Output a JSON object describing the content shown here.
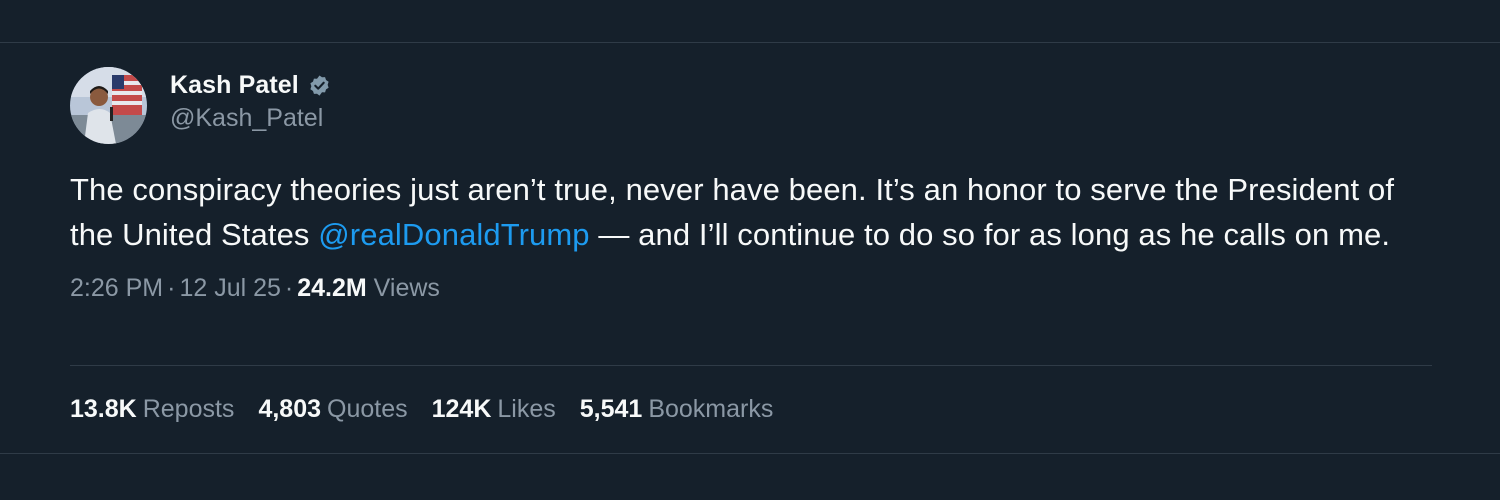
{
  "author": {
    "display_name": "Kash Patel",
    "handle": "@Kash_Patel",
    "verified_icon": "verified-badge-icon"
  },
  "tweet": {
    "text_part1": "The conspiracy theories just aren’t true, never have been. It’s an honor to serve the President of the United States ",
    "mention": "@realDonaldTrump",
    "text_part2": " — and I’ll continue to do so for as long as he calls on me."
  },
  "meta": {
    "time": "2:26 PM",
    "date": "12 Jul 25",
    "separator": "·",
    "views_count": "24.2M",
    "views_label": "Views"
  },
  "stats": [
    {
      "count": "13.8K",
      "label": "Reposts"
    },
    {
      "count": "4,803",
      "label": "Quotes"
    },
    {
      "count": "124K",
      "label": "Likes"
    },
    {
      "count": "5,541",
      "label": "Bookmarks"
    }
  ],
  "colors": {
    "background": "#15202b",
    "text": "#f7f9f9",
    "secondary": "#8b98a5",
    "link": "#1d9bf0",
    "divider": "#2f3b47"
  }
}
